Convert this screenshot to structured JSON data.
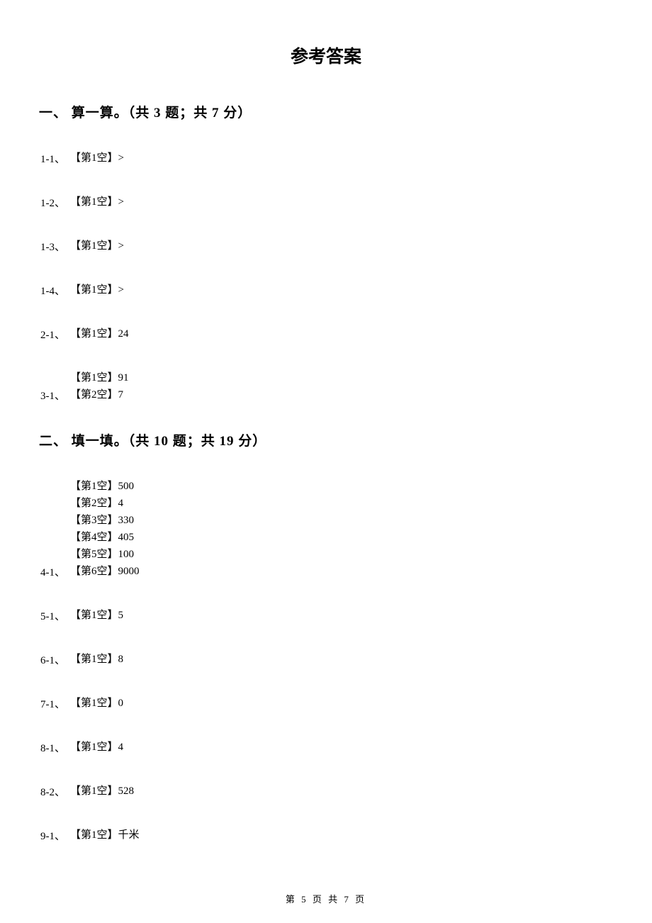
{
  "title": "参考答案",
  "section1": {
    "header": "一、 算一算。（共 3 题；共 7 分）",
    "answers": [
      {
        "num": "1-1、",
        "content": "【第1空】>"
      },
      {
        "num": "1-2、",
        "content": "【第1空】>"
      },
      {
        "num": "1-3、",
        "content": "【第1空】>"
      },
      {
        "num": "1-4、",
        "content": "【第1空】>"
      },
      {
        "num": "2-1、",
        "content": "【第1空】24"
      },
      {
        "num": "3-1、",
        "content": "【第1空】91\n【第2空】7"
      }
    ]
  },
  "section2": {
    "header": "二、 填一填。（共 10 题；共 19 分）",
    "answers": [
      {
        "num": "4-1、",
        "content": "【第1空】500\n【第2空】4\n【第3空】330\n【第4空】405\n【第5空】100\n【第6空】9000"
      },
      {
        "num": "5-1、",
        "content": "【第1空】5"
      },
      {
        "num": "6-1、",
        "content": "【第1空】8"
      },
      {
        "num": "7-1、",
        "content": "【第1空】0"
      },
      {
        "num": "8-1、",
        "content": "【第1空】4"
      },
      {
        "num": "8-2、",
        "content": "【第1空】528"
      },
      {
        "num": "9-1、",
        "content": "【第1空】千米"
      }
    ]
  },
  "footer": "第 5 页 共 7 页"
}
